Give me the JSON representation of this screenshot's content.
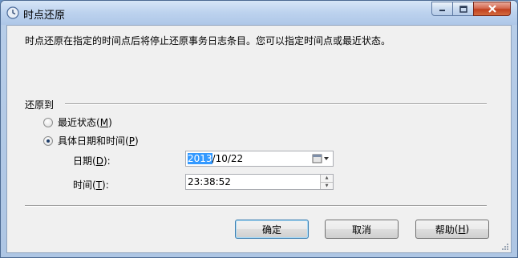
{
  "window": {
    "title": "时点还原",
    "controls": [
      "minimize-icon",
      "maximize-icon",
      "close-icon"
    ]
  },
  "description": "时点还原在指定的时间点后将停止还原事务日志条目。您可以指定时间点或最近状态。",
  "restore_to": {
    "label": "还原到",
    "options": [
      {
        "label": "最近状态",
        "accel": "M",
        "checked": false
      },
      {
        "label": "具体日期和时间",
        "accel": "P",
        "checked": true
      }
    ]
  },
  "date": {
    "label": "日期",
    "accel": "D",
    "colon": ":",
    "value_selected": "2013",
    "value_rest": "/10/22",
    "icon": "calendar-dropdown-icon"
  },
  "time": {
    "label": "时间",
    "accel": "T",
    "colon": ":",
    "value": "23:38:52",
    "icon": "spinner-icon"
  },
  "buttons": {
    "ok": "确定",
    "cancel": "取消",
    "help": "帮助",
    "help_accel": "H"
  },
  "colors": {
    "selection": "#3399ff",
    "titlebar": "#bcd2ee",
    "close_button": "#c1401f"
  }
}
